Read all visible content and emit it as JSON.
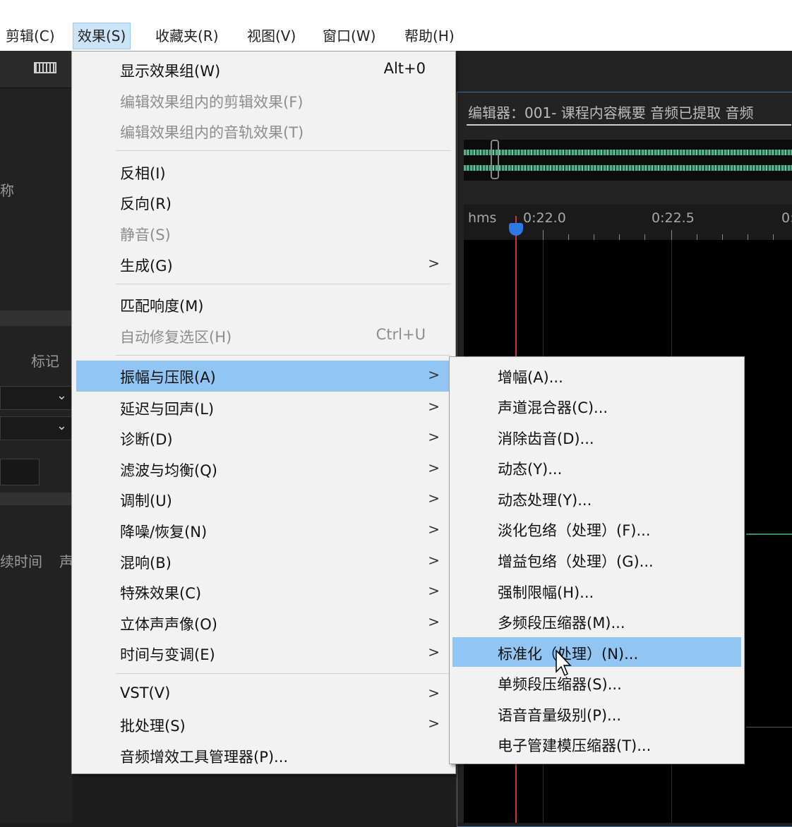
{
  "menubar": {
    "items": [
      {
        "label": "剪辑(C)"
      },
      {
        "label": "效果(S)"
      },
      {
        "label": "收藏夹(R)"
      },
      {
        "label": "视图(V)"
      },
      {
        "label": "窗口(W)"
      },
      {
        "label": "帮助(H)"
      }
    ]
  },
  "left_panel": {
    "name_label": "称",
    "marker_label": "标记",
    "duration_label": "续时间",
    "col_label": "声"
  },
  "editor": {
    "title": "编辑器：001- 课程内容概要 音频已提取 音频",
    "ruler_unit": "hms",
    "t1": "0:22.0",
    "t2": "0:22.5",
    "t3": "0:"
  },
  "effects_menu": {
    "items": [
      {
        "label": "显示效果组(W)",
        "shortcut": "Alt+0"
      },
      {
        "label": "编辑效果组内的剪辑效果(F)"
      },
      {
        "label": "编辑效果组内的音轨效果(T)"
      },
      {
        "label": "反相(I)"
      },
      {
        "label": "反向(R)"
      },
      {
        "label": "静音(S)"
      },
      {
        "label": "生成(G)",
        "arrow": ">"
      },
      {
        "label": "匹配响度(M)"
      },
      {
        "label": "自动修复选区(H)",
        "shortcut": "Ctrl+U"
      },
      {
        "label": "振幅与压限(A)",
        "arrow": ">"
      },
      {
        "label": "延迟与回声(L)",
        "arrow": ">"
      },
      {
        "label": "诊断(D)",
        "arrow": ">"
      },
      {
        "label": "滤波与均衡(Q)",
        "arrow": ">"
      },
      {
        "label": "调制(U)",
        "arrow": ">"
      },
      {
        "label": "降噪/恢复(N)",
        "arrow": ">"
      },
      {
        "label": "混响(B)",
        "arrow": ">"
      },
      {
        "label": "特殊效果(C)",
        "arrow": ">"
      },
      {
        "label": "立体声声像(O)",
        "arrow": ">"
      },
      {
        "label": "时间与变调(E)",
        "arrow": ">"
      },
      {
        "label": "VST(V)",
        "arrow": ">"
      },
      {
        "label": "批处理(S)",
        "arrow": ">"
      },
      {
        "label": "音频增效工具管理器(P)..."
      }
    ]
  },
  "amplitude_submenu": {
    "items": [
      {
        "label": "增幅(A)..."
      },
      {
        "label": "声道混合器(C)..."
      },
      {
        "label": "消除齿音(D)..."
      },
      {
        "label": "动态(Y)..."
      },
      {
        "label": "动态处理(Y)..."
      },
      {
        "label": "淡化包络（处理）(F)..."
      },
      {
        "label": "增益包络（处理）(G)..."
      },
      {
        "label": "强制限幅(H)..."
      },
      {
        "label": "多频段压缩器(M)..."
      },
      {
        "label": "标准化（处理）(N)..."
      },
      {
        "label": "单频段压缩器(S)..."
      },
      {
        "label": "语音音量级别(P)..."
      },
      {
        "label": "电子管建模压缩器(T)..."
      }
    ]
  }
}
